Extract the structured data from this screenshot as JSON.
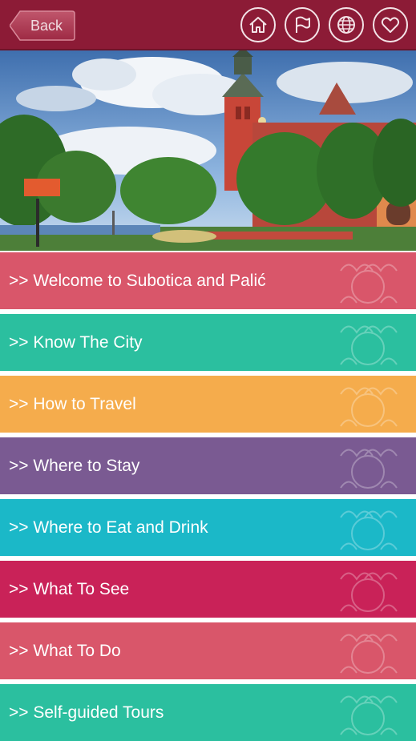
{
  "header": {
    "back_label": "Back",
    "icons": [
      "home-icon",
      "flag-icon",
      "globe-icon",
      "heart-icon"
    ]
  },
  "colors": {
    "header": "#8c1b36",
    "items": [
      "#d9566a",
      "#2bbf9f",
      "#f5ac4c",
      "#7a5a92",
      "#1bb8c8",
      "#c92258",
      "#d9566a",
      "#2bbf9f"
    ]
  },
  "menu": {
    "items": [
      {
        "label": ">> Welcome to Subotica and Palić"
      },
      {
        "label": ">> Know The City"
      },
      {
        "label": ">> How to Travel"
      },
      {
        "label": ">> Where to Stay"
      },
      {
        "label": ">> Where to Eat and Drink"
      },
      {
        "label": ">> What To See"
      },
      {
        "label": ">> What To Do"
      },
      {
        "label": ">> Self-guided Tours"
      }
    ]
  }
}
